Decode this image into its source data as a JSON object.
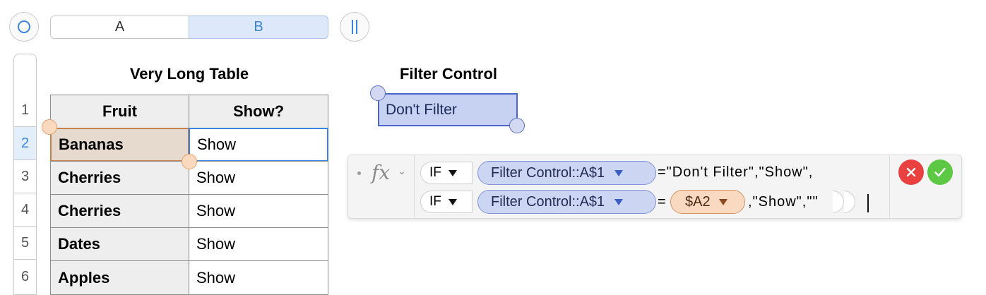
{
  "column_headers": [
    "A",
    "B"
  ],
  "row_numbers": [
    "1",
    "2",
    "3",
    "4",
    "5",
    "6"
  ],
  "long_table": {
    "title": "Very Long Table",
    "headers": [
      "Fruit",
      "Show?"
    ],
    "rows": [
      {
        "fruit": "Bananas",
        "show": "Show"
      },
      {
        "fruit": "Cherries",
        "show": "Show"
      },
      {
        "fruit": "Cherries",
        "show": "Show"
      },
      {
        "fruit": "Dates",
        "show": "Show"
      },
      {
        "fruit": "Apples",
        "show": "Show"
      }
    ]
  },
  "filter_control": {
    "title": "Filter Control",
    "value": "Don't Filter"
  },
  "formula": {
    "fx_label": "fx",
    "line1": {
      "function": "IF",
      "reference": "Filter Control::A$1",
      "text": "=\"Don't Filter\",\"Show\","
    },
    "line2": {
      "function": "IF",
      "reference": "Filter Control::A$1",
      "equals": "=",
      "cell_ref": "$A2",
      "text": ",\"Show\",\"\""
    }
  },
  "colors": {
    "accent_blue": "#3a83de",
    "cancel_red": "#e94040",
    "accept_green": "#5cc844"
  }
}
